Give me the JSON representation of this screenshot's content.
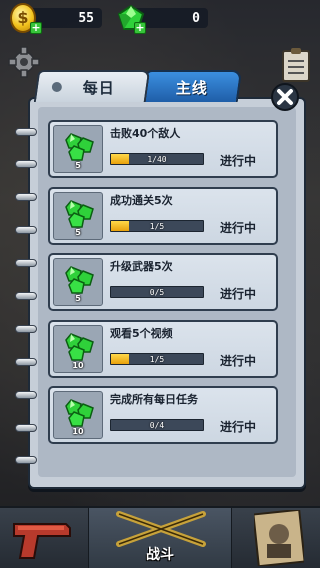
{
  "currency": {
    "coins": "55",
    "gems": "0",
    "coin_icon_glyph": "$"
  },
  "tabs": [
    {
      "label": "每日",
      "active": true
    },
    {
      "label": "主线",
      "active": false
    }
  ],
  "tasks": [
    {
      "title": "击败40个敌人",
      "reward": "5",
      "progress_text": "1/40",
      "progress": 0.025,
      "status": "进行中"
    },
    {
      "title": "成功通关5次",
      "reward": "5",
      "progress_text": "1/5",
      "progress": 0.2,
      "status": "进行中"
    },
    {
      "title": "升级武器5次",
      "reward": "5",
      "progress_text": "0/5",
      "progress": 0.0,
      "status": "进行中"
    },
    {
      "title": "观看5个视频",
      "reward": "10",
      "progress_text": "1/5",
      "progress": 0.2,
      "status": "进行中"
    },
    {
      "title": "完成所有每日任务",
      "reward": "10",
      "progress_text": "0/4",
      "progress": 0.0,
      "status": "进行中"
    }
  ],
  "bottom_nav": {
    "battle_label": "战斗"
  },
  "colors": {
    "progress_fill": "#f2b51f",
    "tab_active": "#dfe6ee",
    "tab_inactive": "#2f78c8",
    "gem": "#2fd13a"
  },
  "icons": {
    "coin": "coin-icon",
    "gem": "gem-icon",
    "settings": "gear-icon",
    "quests": "clipboard-icon",
    "close": "close-icon",
    "weapons": "pistol-icon",
    "battle": "crossed-rifles-icon",
    "profile": "wanted-poster-icon"
  }
}
